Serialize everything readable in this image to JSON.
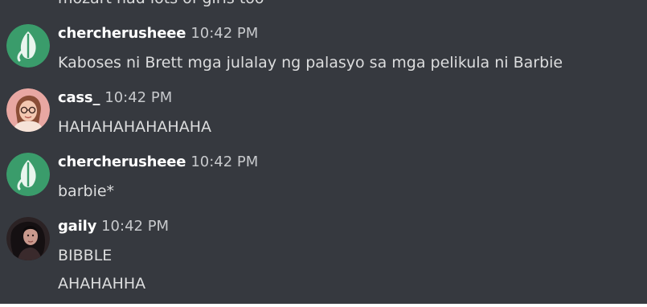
{
  "channel": {
    "previous_message_partial": "mozart had lots of girls too"
  },
  "messages": [
    {
      "author": "chercherusheee",
      "time": "10:42 PM",
      "lines": [
        "Kaboses ni Brett mga julalay ng palasyo sa mga pelikula ni Barbie"
      ],
      "avatar": "green-leaf-avatar"
    },
    {
      "author": "cass_",
      "time": "10:42 PM",
      "lines": [
        "HAHAHAHAHAHAHA"
      ],
      "avatar": "girl-glasses-avatar"
    },
    {
      "author": "chercherusheee",
      "time": "10:42 PM",
      "lines": [
        "barbie*"
      ],
      "avatar": "green-leaf-avatar"
    },
    {
      "author": "gaily",
      "time": "10:42 PM",
      "lines": [
        "BIBBLE",
        "AHAHAHHA"
      ],
      "avatar": "dark-photo-avatar"
    }
  ],
  "colors": {
    "background": "#36393f",
    "author": "#ffffff",
    "text": "#dcddde",
    "timestamp": "#c7c9cc",
    "leaf_avatar_bg": "#3a9c6b"
  }
}
